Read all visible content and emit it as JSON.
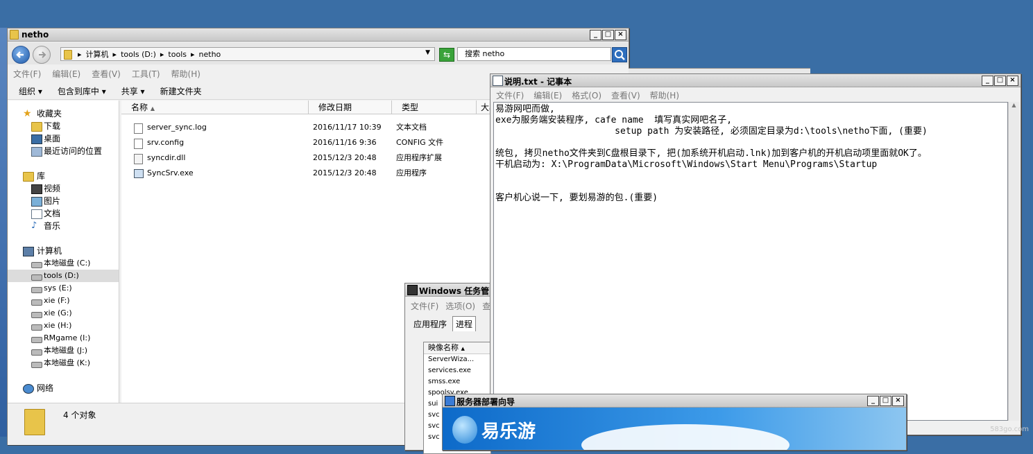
{
  "explorer": {
    "title": "netho",
    "breadcrumbs": [
      "计算机",
      "tools (D:)",
      "tools",
      "netho"
    ],
    "search_placeholder": "搜索 netho",
    "menu": [
      "文件(F)",
      "编辑(E)",
      "查看(V)",
      "工具(T)",
      "帮助(H)"
    ],
    "toolbar": {
      "organize": "组织",
      "include": "包含到库中",
      "share": "共享",
      "new_folder": "新建文件夹"
    },
    "nav": {
      "favorites": "收藏夹",
      "fav_items": [
        "下载",
        "桌面",
        "最近访问的位置"
      ],
      "libraries": "库",
      "lib_items": [
        "视频",
        "图片",
        "文档",
        "音乐"
      ],
      "computer": "计算机",
      "drives": [
        "本地磁盘 (C:)",
        "tools (D:)",
        "sys (E:)",
        "xie (F:)",
        "xie (G:)",
        "xie (H:)",
        "RMgame (I:)",
        "本地磁盘 (J:)",
        "本地磁盘 (K:)"
      ],
      "network": "网络"
    },
    "columns": {
      "name": "名称",
      "date": "修改日期",
      "type": "类型",
      "size": "大小"
    },
    "files": [
      {
        "name": "server_sync.log",
        "date": "2016/11/17 10:39",
        "type": "文本文档"
      },
      {
        "name": "srv.config",
        "date": "2016/11/16 9:36",
        "type": "CONFIG 文件"
      },
      {
        "name": "syncdir.dll",
        "date": "2015/12/3 20:48",
        "type": "应用程序扩展"
      },
      {
        "name": "SyncSrv.exe",
        "date": "2015/12/3 20:48",
        "type": "应用程序"
      }
    ],
    "status": "4 个对象"
  },
  "notepad": {
    "title": "说明.txt - 记事本",
    "menu": [
      "文件(F)",
      "编辑(E)",
      "格式(O)",
      "查看(V)",
      "帮助(H)"
    ],
    "lines": [
      "易游网吧而做,",
      "exe为服务端安装程序, cafe name  填写真实网吧名子,",
      "                      setup path 为安装路径, 必须固定目录为d:\\tools\\netho下面, (重要)",
      "",
      "统包, 拷贝netho文件夹到C盘根目录下, 把(加系统开机启动.lnk)加到客户机的开机启动项里面就OK了。",
      "干机启动为: X:\\ProgramData\\Microsoft\\Windows\\Start Menu\\Programs\\Startup",
      "",
      "",
      "客户机心说一下, 要划易游的包.(重要)"
    ]
  },
  "taskmgr": {
    "title": "Windows 任务管",
    "menu": [
      "文件(F)",
      "选项(O)",
      "查"
    ],
    "tabs": [
      "应用程序",
      "进程"
    ],
    "column": "映像名称",
    "processes": [
      "ServerWiza...",
      "services.exe",
      "smss.exe",
      "spoolsv.exe",
      "sui",
      "svc",
      "svc",
      "svc"
    ]
  },
  "wizard": {
    "title": "服务器部署向导",
    "brand": "易乐游"
  },
  "watermark": "583go.com"
}
